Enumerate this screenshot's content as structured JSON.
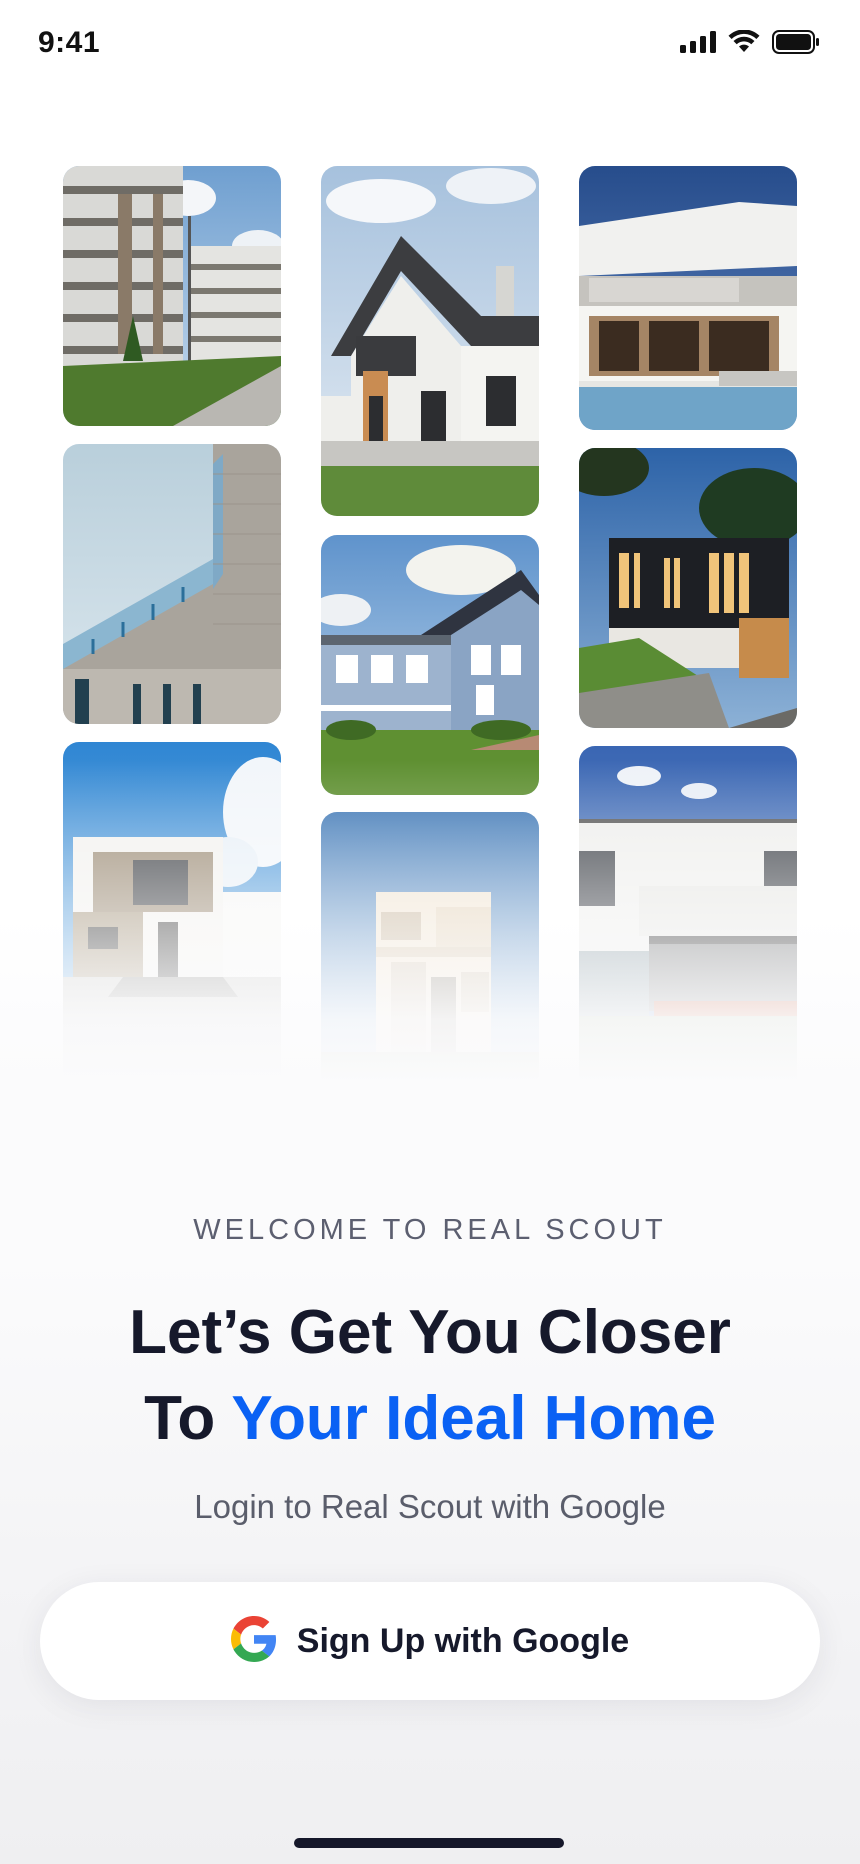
{
  "status_bar": {
    "time": "9:41",
    "icons": [
      "signal-icon",
      "wifi-icon",
      "battery-icon"
    ]
  },
  "gallery": {
    "photos": [
      {
        "name": "apartment-complex-photo"
      },
      {
        "name": "angular-facade-photo"
      },
      {
        "name": "modern-white-house-photo"
      },
      {
        "name": "gabled-white-house-photo"
      },
      {
        "name": "blue-siding-house-photo"
      },
      {
        "name": "cream-cube-house-photo"
      },
      {
        "name": "flat-roof-pool-house-photo"
      },
      {
        "name": "dark-modern-house-photo"
      },
      {
        "name": "glass-pavilion-house-photo"
      }
    ]
  },
  "welcome": {
    "eyebrow": "WELCOME TO REAL SCOUT",
    "headline_line1": "Let’s Get You Closer",
    "headline_line2_prefix": "To ",
    "headline_line2_accent": "Your Ideal Home",
    "subtitle": "Login to Real Scout with Google"
  },
  "auth": {
    "google_button_label": "Sign Up with Google",
    "google_icon": "google-icon"
  },
  "colors": {
    "accent": "#0a61f4",
    "heading": "#16192b",
    "muted": "#5a5d6b"
  }
}
